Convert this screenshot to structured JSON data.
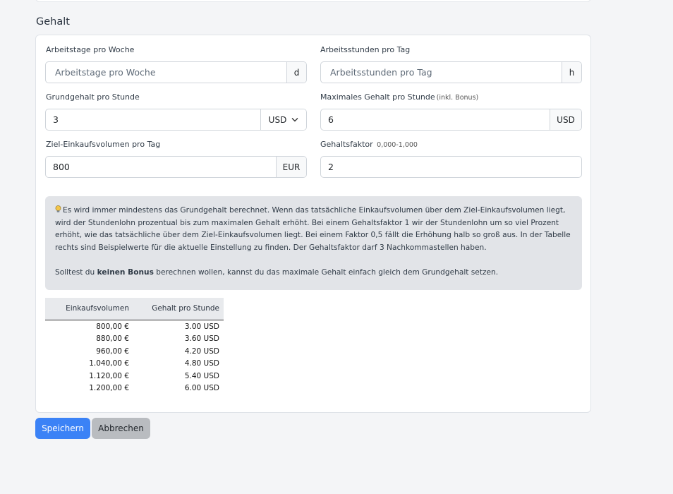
{
  "section": {
    "title": "Gehalt"
  },
  "fields": {
    "workdays": {
      "label": "Arbeitstage pro Woche",
      "placeholder": "Arbeitstage pro Woche",
      "value": "",
      "addon": "d"
    },
    "workhours": {
      "label": "Arbeitsstunden pro Tag",
      "placeholder": "Arbeitsstunden pro Tag",
      "value": "",
      "addon": "h"
    },
    "base_salary": {
      "label": "Grundgehalt pro Stunde",
      "value": "3",
      "currency": "USD"
    },
    "max_salary": {
      "label": "Maximales Gehalt pro Stunde",
      "label_note": "(inkl. Bonus)",
      "value": "6",
      "addon": "USD"
    },
    "target_volume": {
      "label": "Ziel-Einkaufsvolumen pro Tag",
      "value": "800",
      "addon": "EUR"
    },
    "salary_factor": {
      "label": "Gehaltsfaktor",
      "label_note": "0,000-1,000",
      "value": "2"
    }
  },
  "info": {
    "paragraph1": "Es wird immer mindestens das Grundgehalt berechnet. Wenn das tatsächliche Einkaufsvolumen über dem Ziel-Einkaufsvolumen liegt, wird der Stundenlohn prozentual bis zum maximalen Gehalt erhöht. Bei einem Gehaltsfaktor 1 wir der Stundenlohn um so viel Prozent erhöht, wie das tatsächliche über dem Ziel-Einkaufsvolumen liegt. Bei einem Faktor 0,5 fällt die Erhöhung halb so groß aus. In der Tabelle rechts sind Beispielwerte für die aktuelle Einstellung zu finden. Der Gehaltsfaktor darf 3 Nachkommastellen haben.",
    "p2_before": "Solltest du ",
    "p2_bold": "keinen Bonus",
    "p2_after": " berechnen wollen, kannst du das maximale Gehalt einfach gleich dem Grundgehalt setzen."
  },
  "table": {
    "headers": [
      "Einkaufsvolumen",
      "Gehalt pro Stunde"
    ],
    "rows": [
      [
        "800,00 €",
        "3.00 USD"
      ],
      [
        "880,00 €",
        "3.60 USD"
      ],
      [
        "960,00 €",
        "4.20 USD"
      ],
      [
        "1.040,00 €",
        "4.80 USD"
      ],
      [
        "1.120,00 €",
        "5.40 USD"
      ],
      [
        "1.200,00 €",
        "6.00 USD"
      ]
    ]
  },
  "buttons": {
    "save": "Speichern",
    "cancel": "Abbrechen"
  },
  "colors": {
    "primary": "#3b82f6",
    "secondary": "#b9bcc0",
    "info_bg": "#e2e4e8"
  }
}
